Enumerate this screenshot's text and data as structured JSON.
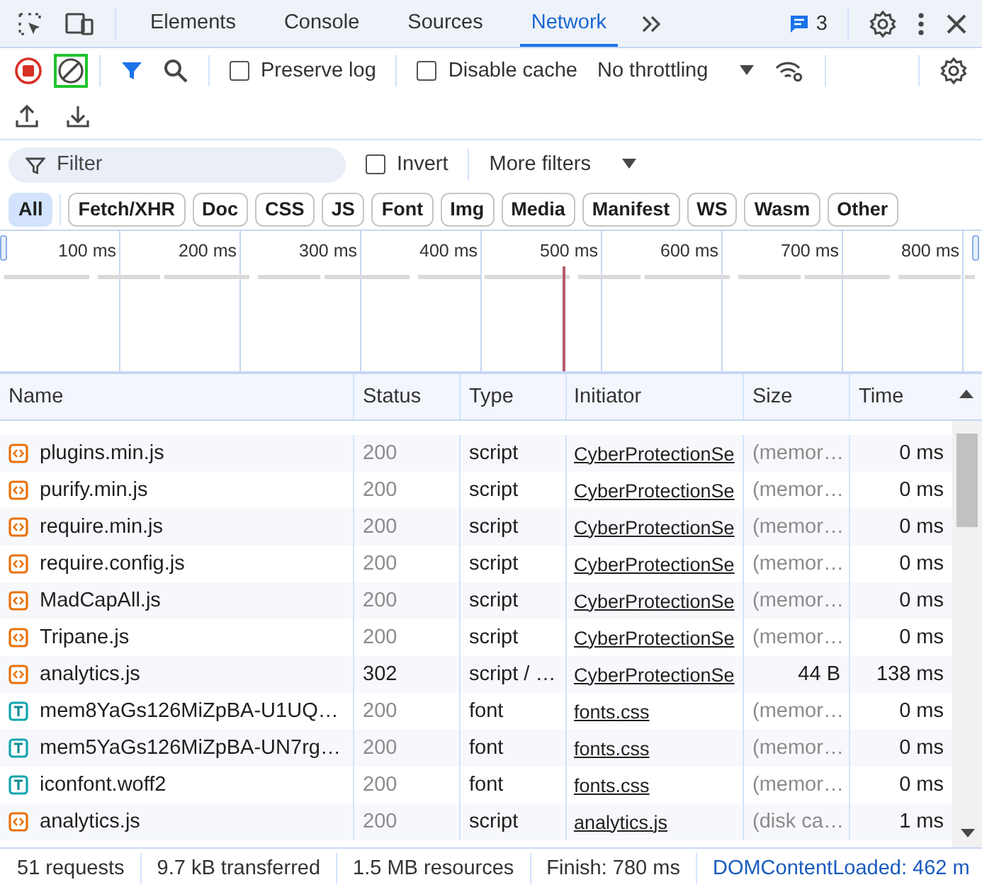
{
  "top_bar": {
    "tabs": [
      {
        "label": "Elements",
        "selected": false
      },
      {
        "label": "Console",
        "selected": false
      },
      {
        "label": "Sources",
        "selected": false
      },
      {
        "label": "Network",
        "selected": true
      }
    ],
    "issues_count": "3"
  },
  "toolbar": {
    "recording": true,
    "clear_highlighted": true,
    "filter_active": true,
    "preserve_log": {
      "label": "Preserve log",
      "checked": false
    },
    "disable_cache": {
      "label": "Disable cache",
      "checked": false
    },
    "throttling": "No throttling"
  },
  "filter_bar": {
    "placeholder": "Filter",
    "invert": {
      "label": "Invert",
      "checked": false
    },
    "more_filters": "More filters"
  },
  "type_filters": [
    {
      "label": "All",
      "selected": true
    },
    {
      "label": "Fetch/XHR",
      "selected": false
    },
    {
      "label": "Doc",
      "selected": false
    },
    {
      "label": "CSS",
      "selected": false
    },
    {
      "label": "JS",
      "selected": false
    },
    {
      "label": "Font",
      "selected": false
    },
    {
      "label": "Img",
      "selected": false
    },
    {
      "label": "Media",
      "selected": false
    },
    {
      "label": "Manifest",
      "selected": false
    },
    {
      "label": "WS",
      "selected": false
    },
    {
      "label": "Wasm",
      "selected": false
    },
    {
      "label": "Other",
      "selected": false
    }
  ],
  "overview": {
    "ticks": [
      "100 ms",
      "200 ms",
      "300 ms",
      "400 ms",
      "500 ms",
      "600 ms",
      "700 ms",
      "800 ms"
    ]
  },
  "table": {
    "columns": [
      "Name",
      "Status",
      "Type",
      "Initiator",
      "Size",
      "Time"
    ],
    "rows": [
      {
        "kind": "script",
        "name": "plugins.min.js",
        "status": "200",
        "type": "script",
        "initiator": "CyberProtectionSe",
        "size": "(memor…",
        "time": "0 ms",
        "from_cache": true
      },
      {
        "kind": "script",
        "name": "purify.min.js",
        "status": "200",
        "type": "script",
        "initiator": "CyberProtectionSe",
        "size": "(memor…",
        "time": "0 ms",
        "from_cache": true
      },
      {
        "kind": "script",
        "name": "require.min.js",
        "status": "200",
        "type": "script",
        "initiator": "CyberProtectionSe",
        "size": "(memor…",
        "time": "0 ms",
        "from_cache": true
      },
      {
        "kind": "script",
        "name": "require.config.js",
        "status": "200",
        "type": "script",
        "initiator": "CyberProtectionSe",
        "size": "(memor…",
        "time": "0 ms",
        "from_cache": true
      },
      {
        "kind": "script",
        "name": "MadCapAll.js",
        "status": "200",
        "type": "script",
        "initiator": "CyberProtectionSe",
        "size": "(memor…",
        "time": "0 ms",
        "from_cache": true
      },
      {
        "kind": "script",
        "name": "Tripane.js",
        "status": "200",
        "type": "script",
        "initiator": "CyberProtectionSe",
        "size": "(memor…",
        "time": "0 ms",
        "from_cache": true
      },
      {
        "kind": "script",
        "name": "analytics.js",
        "status": "302",
        "type": "script / …",
        "initiator": "CyberProtectionSe",
        "size": "44 B",
        "time": "138 ms",
        "from_cache": false
      },
      {
        "kind": "font",
        "name": "mem8YaGs126MiZpBA-U1UQ…",
        "status": "200",
        "type": "font",
        "initiator": "fonts.css",
        "size": "(memor…",
        "time": "0 ms",
        "from_cache": true
      },
      {
        "kind": "font",
        "name": "mem5YaGs126MiZpBA-UN7rg…",
        "status": "200",
        "type": "font",
        "initiator": "fonts.css",
        "size": "(memor…",
        "time": "0 ms",
        "from_cache": true
      },
      {
        "kind": "font",
        "name": "iconfont.woff2",
        "status": "200",
        "type": "font",
        "initiator": "fonts.css",
        "size": "(memor…",
        "time": "0 ms",
        "from_cache": true
      },
      {
        "kind": "script",
        "name": "analytics.js",
        "status": "200",
        "type": "script",
        "initiator": "analytics.js",
        "size": "(disk ca…",
        "time": "1 ms",
        "from_cache": true
      }
    ]
  },
  "status_bar": [
    {
      "text": "51 requests",
      "link": false
    },
    {
      "text": "9.7 kB transferred",
      "link": false
    },
    {
      "text": "1.5 MB resources",
      "link": false
    },
    {
      "text": "Finish: 780 ms",
      "link": false
    },
    {
      "text": "DOMContentLoaded: 462 m",
      "link": true
    }
  ]
}
